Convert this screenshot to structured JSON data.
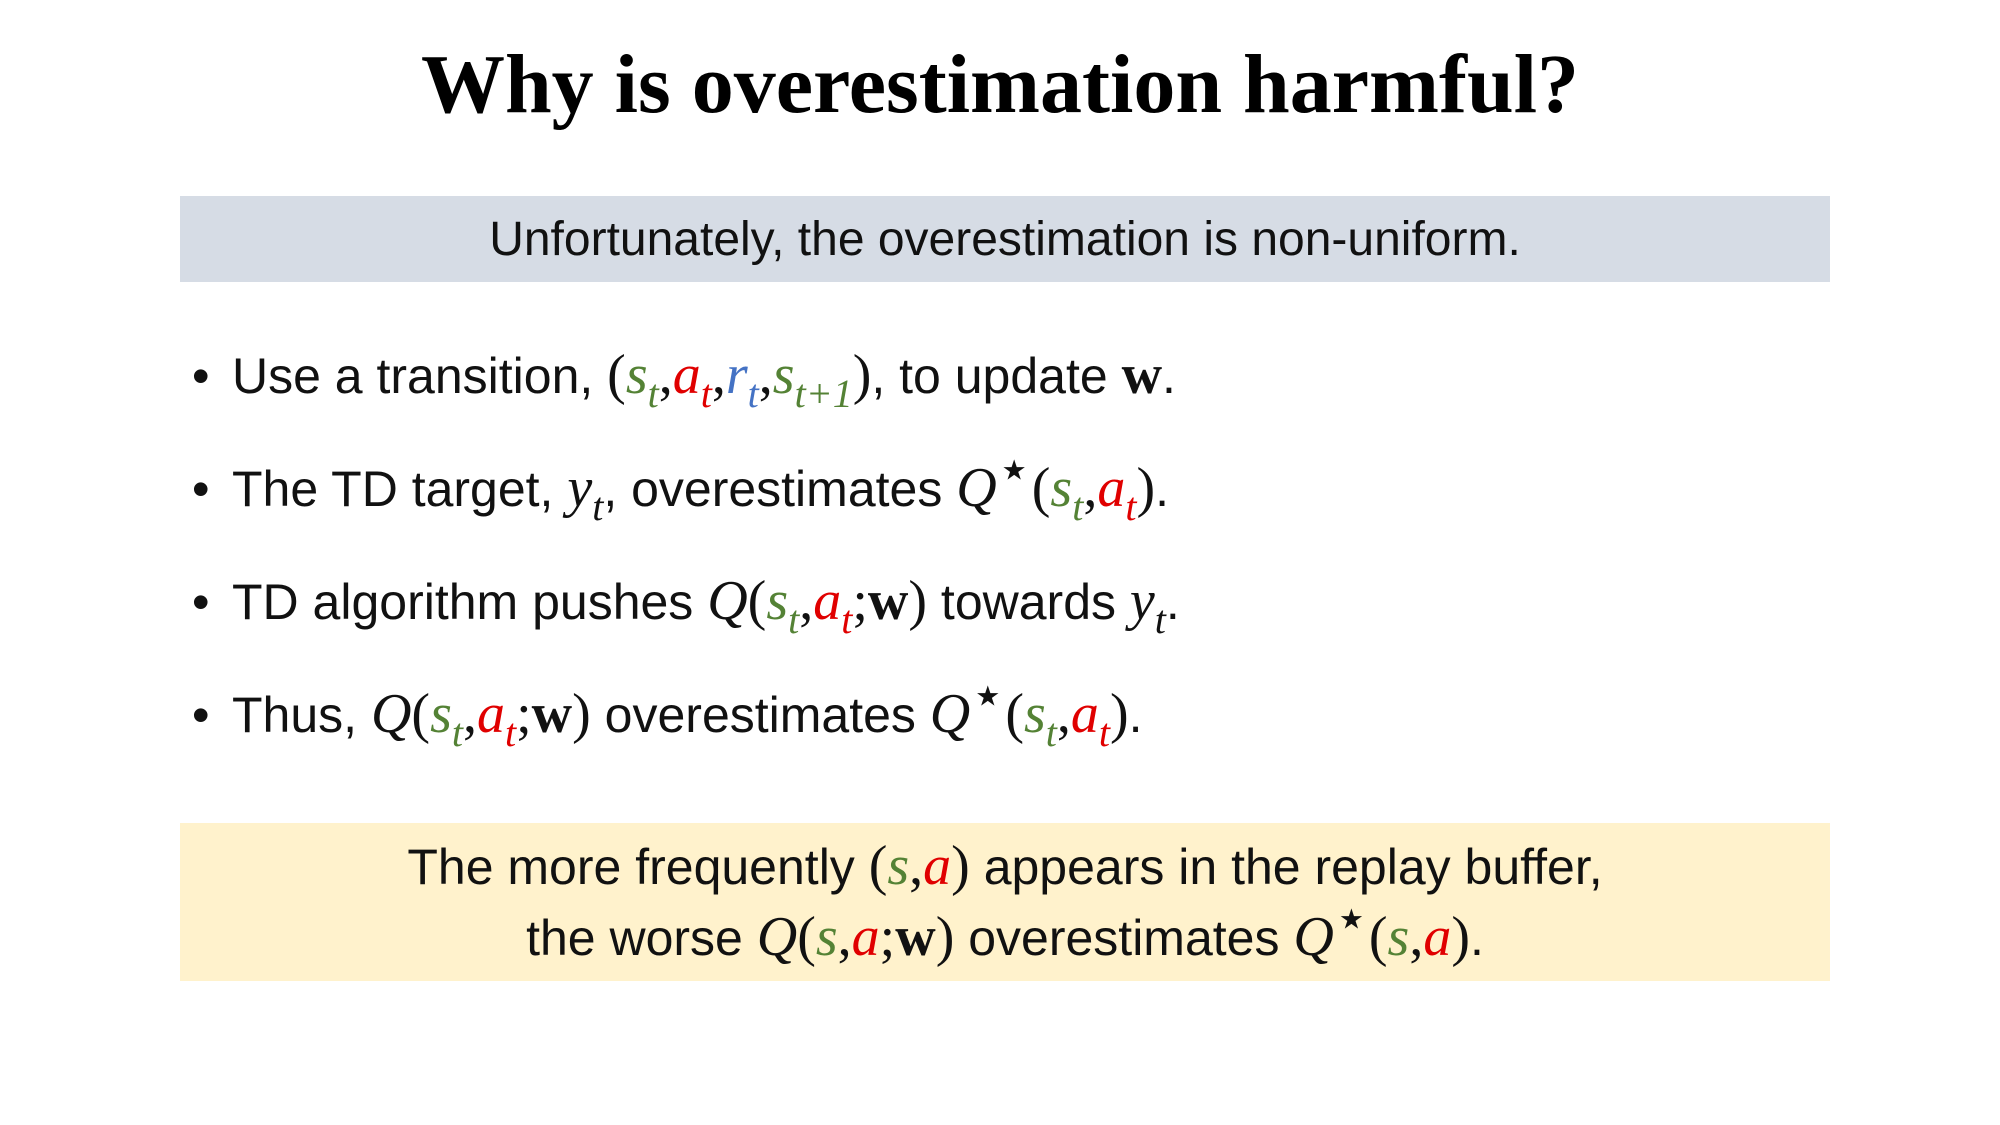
{
  "title": "Why is overestimation harmful?",
  "top_banner": "Unfortunately, the overestimation is non-uniform.",
  "bullet_marker": "•",
  "bullets": [
    {
      "pre": "Use a transition, ",
      "post": ", to update ",
      "end": "."
    },
    {
      "pre": "The TD target, ",
      "mid": ", overestimates ",
      "end": "."
    },
    {
      "pre": "TD algorithm pushes ",
      "mid": " towards ",
      "end": "."
    },
    {
      "pre": "Thus, ",
      "mid": " overestimates ",
      "end": "."
    }
  ],
  "bottom_banner": {
    "line1_pre": "The more frequently ",
    "line1_post": " appears in the replay buffer,",
    "line2_pre": "the worse ",
    "line2_mid": " overestimates ",
    "line2_end": "."
  },
  "symbols": {
    "s": "s",
    "a": "a",
    "r": "r",
    "y": "y",
    "Q": "Q",
    "w": "w",
    "t": "t",
    "t1": "t+1",
    "star": "⋆",
    "lp": "(",
    "rp": ")",
    "comma": ",",
    "semi": ";"
  },
  "colors": {
    "state": "#548235",
    "action": "#e00000",
    "reward": "#4472c4",
    "top_banner_bg": "#d6dce5",
    "bottom_banner_bg": "#fff2cc"
  }
}
